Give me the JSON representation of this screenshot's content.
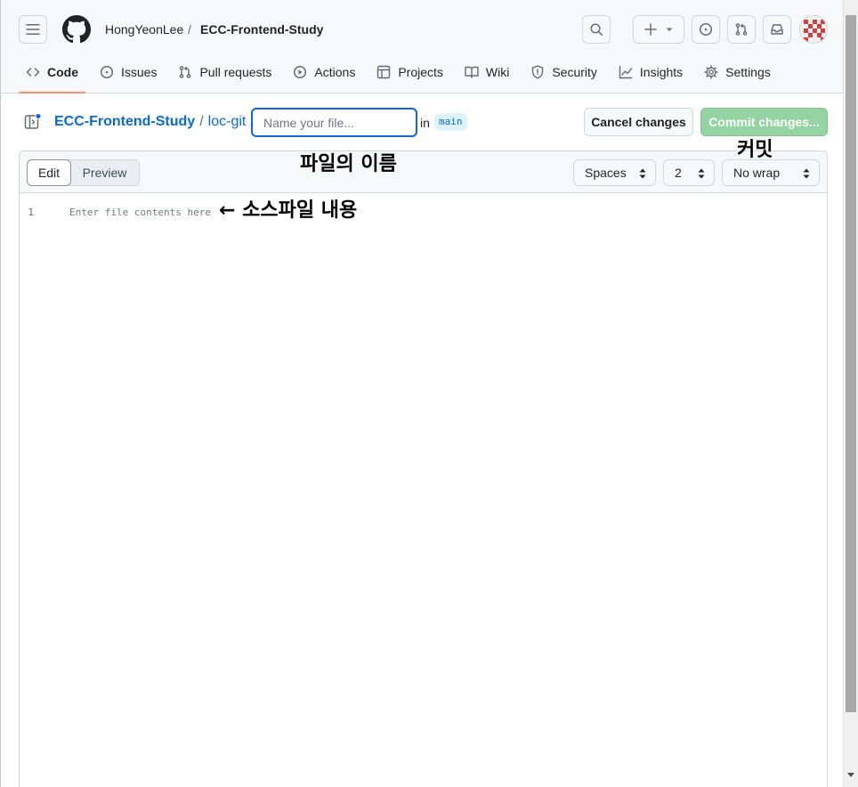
{
  "header": {
    "owner": "HongYeonLee",
    "separator": "/",
    "repo": "ECC-Frontend-Study"
  },
  "nav": {
    "items": [
      {
        "label": "Code",
        "icon": "code-icon",
        "selected": true
      },
      {
        "label": "Issues",
        "icon": "issue-icon"
      },
      {
        "label": "Pull requests",
        "icon": "pull-request-icon"
      },
      {
        "label": "Actions",
        "icon": "play-icon"
      },
      {
        "label": "Projects",
        "icon": "table-icon"
      },
      {
        "label": "Wiki",
        "icon": "book-icon"
      },
      {
        "label": "Security",
        "icon": "shield-icon"
      },
      {
        "label": "Insights",
        "icon": "graph-icon"
      },
      {
        "label": "Settings",
        "icon": "gear-icon"
      }
    ]
  },
  "editor_header": {
    "repo_link": "ECC-Frontend-Study",
    "dir_link": "loc-git",
    "slash": "/",
    "filename_placeholder": "Name your file...",
    "in_label": "in",
    "branch": "main",
    "cancel_label": "Cancel changes",
    "commit_label": "Commit changes..."
  },
  "editor": {
    "tab_edit": "Edit",
    "tab_preview": "Preview",
    "indent_mode": "Spaces",
    "indent_size": "2",
    "wrap_mode": "No wrap",
    "line_number": "1",
    "content_placeholder": "Enter file contents here"
  },
  "annotations": {
    "file_name": "파일의 이름",
    "commit": "커밋",
    "source_content": "← 소스파일 내용"
  },
  "colors": {
    "accent_blue": "#0969da",
    "commit_green_disabled": "#94d3a2",
    "nav_underline": "#fd8c73",
    "header_bg": "#f6f8fa"
  }
}
